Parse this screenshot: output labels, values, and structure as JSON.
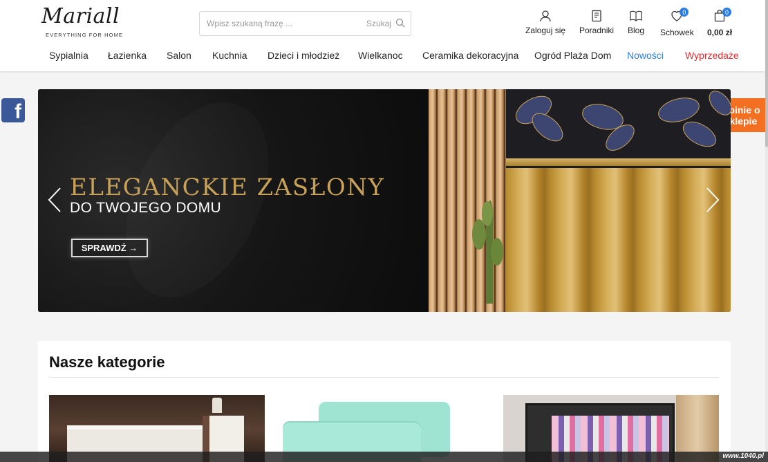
{
  "logo": {
    "script": "Mariall",
    "tagline": "EVERYTHING FOR HOME"
  },
  "search": {
    "placeholder": "Wpisz szukaną frazę ...",
    "value": "",
    "button_label": "Szukaj"
  },
  "header_actions": {
    "login": "Zaloguj się",
    "guides": "Poradniki",
    "blog": "Blog",
    "wishlist": {
      "label": "Schowek",
      "count": "0"
    },
    "cart": {
      "total": "0,00 zł",
      "count": "0"
    }
  },
  "nav": {
    "items": [
      "Sypialnia",
      "Łazienka",
      "Salon",
      "Kuchnia",
      "Dzieci i młodzież",
      "Wielkanoc",
      "Ceramika dekoracyjna",
      "Ogród Plaża Dom"
    ],
    "new": "Nowości",
    "sale": "Wyprzedaże"
  },
  "side": {
    "facebook": "f",
    "opinions": "Opinie o sklepie"
  },
  "banner": {
    "title": "ELEGANCKIE ZASŁONY",
    "subtitle": "DO TWOJEGO DOMU",
    "cta": "SPRAWDŹ →"
  },
  "categories": {
    "title": "Nasze kategorie"
  },
  "watermark": "www.1040.pl",
  "colors": {
    "accent_blue": "#2a7de1",
    "sale_red": "#e4282e",
    "opinions_orange": "#f36f21",
    "gold": "#c9a25a"
  }
}
